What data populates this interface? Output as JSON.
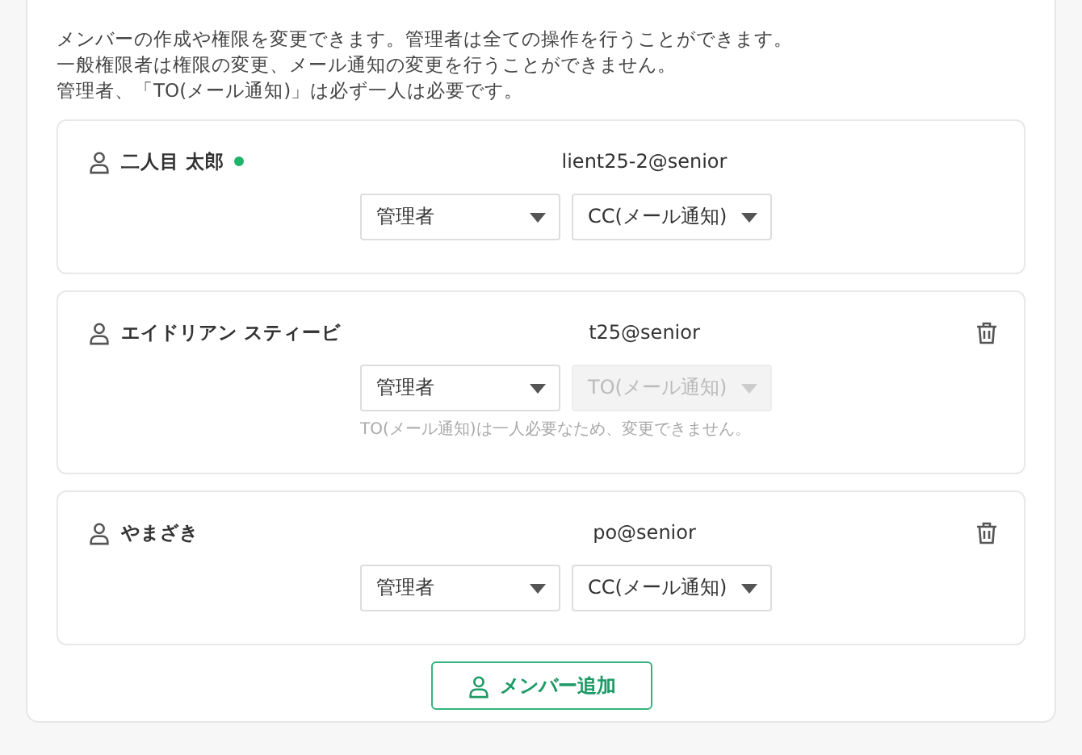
{
  "description": [
    "メンバーの作成や権限を変更できます。管理者は全ての操作を行うことができます。",
    "一般権限者は権限の変更、メール通知の変更を行うことができません。",
    "管理者、「TO(メール通知)」は必ず一人は必要です。"
  ],
  "members": [
    {
      "name": "二人目 太郎",
      "online": true,
      "email": "lient25-2@senior",
      "deletable": false,
      "role": {
        "value": "管理者",
        "disabled": false
      },
      "notification": {
        "value": "CC(メール通知)",
        "disabled": false
      }
    },
    {
      "name": "エイドリアン スティービ",
      "online": false,
      "email": "t25@senior",
      "deletable": true,
      "role": {
        "value": "管理者",
        "disabled": false
      },
      "notification": {
        "value": "TO(メール通知)",
        "disabled": true
      },
      "note": "TO(メール通知)は一人必要なため、変更できません。"
    },
    {
      "name": "やまざき",
      "online": false,
      "email": "po@senior",
      "deletable": true,
      "role": {
        "value": "管理者",
        "disabled": false
      },
      "notification": {
        "value": "CC(メール通知)",
        "disabled": false
      }
    }
  ],
  "add_button": {
    "label": "メンバー追加"
  }
}
